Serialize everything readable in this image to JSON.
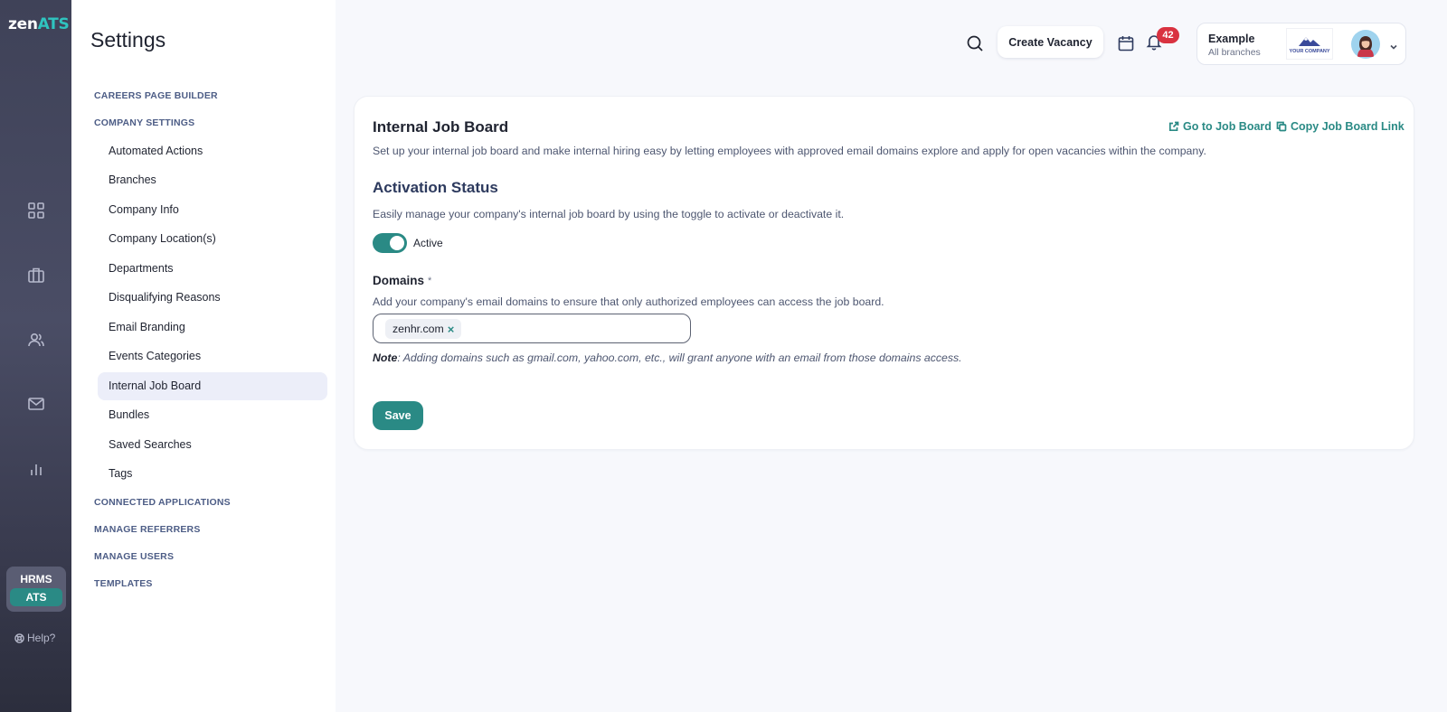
{
  "app": {
    "logo_zen": "zen",
    "logo_ats": "ATS"
  },
  "rail": {
    "icons": [
      "dashboard-icon",
      "briefcase-icon",
      "users-icon",
      "mail-icon",
      "analytics-icon"
    ],
    "switcher": {
      "hrms": "HRMS",
      "ats": "ATS"
    },
    "help": "Help?"
  },
  "settings": {
    "title": "Settings",
    "sections": {
      "careers": "CAREERS PAGE BUILDER",
      "company": "COMPANY SETTINGS",
      "connected": "CONNECTED APPLICATIONS",
      "referrers": "MANAGE REFERRERS",
      "users": "MANAGE USERS",
      "templates": "TEMPLATES"
    },
    "items": [
      "Automated Actions",
      "Branches",
      "Company Info",
      "Company Location(s)",
      "Departments",
      "Disqualifying Reasons",
      "Email Branding",
      "Events Categories",
      "Internal Job Board",
      "Bundles",
      "Saved Searches",
      "Tags"
    ],
    "active_item": "Internal Job Board"
  },
  "header": {
    "create_vacancy": "Create Vacancy",
    "notifications_count": "42",
    "account": {
      "name": "Example",
      "branches": "All branches",
      "company_logo_text": "YOUR COMPANY"
    }
  },
  "card": {
    "title": "Internal Job Board",
    "description": "Set up your internal job board and make internal hiring easy by letting employees with approved email domains explore and apply for open vacancies within the company.",
    "go_to_link": "Go to Job Board",
    "copy_link": "Copy Job Board Link",
    "activation_title": "Activation Status",
    "activation_desc": "Easily manage your company's internal job board by using the toggle to activate or deactivate it.",
    "toggle_label": "Active",
    "toggle_on": true,
    "domains_title": "Domains",
    "domains_required": "*",
    "domains_desc": "Add your company's email domains to ensure that only authorized employees can access the job board.",
    "domains": [
      "zenhr.com"
    ],
    "note_label": "Note",
    "note_text": ": Adding domains such as gmail.com, yahoo.com, etc., will grant anyone with an email from those domains access.",
    "save": "Save"
  },
  "colors": {
    "accent": "#2a8a85",
    "badge": "#d93240",
    "rail_top": "#3f4258",
    "section": "#4d5d86"
  }
}
